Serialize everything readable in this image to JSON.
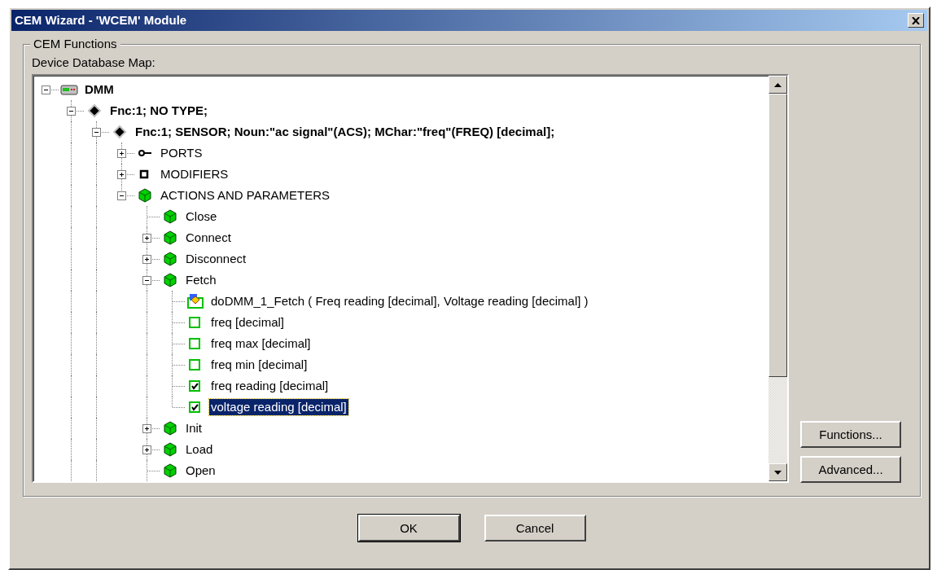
{
  "window": {
    "title": "CEM Wizard - 'WCEM' Module"
  },
  "group": {
    "title": "CEM Functions",
    "tree_label": "Device Database Map:",
    "tree": [
      {
        "label": "DMM",
        "bold": true,
        "kind": "device",
        "expanded": true,
        "selected": false,
        "children": [
          {
            "label": "Fnc:1; NO TYPE;",
            "bold": true,
            "kind": "function",
            "expanded": true,
            "selected": false,
            "continues_below": true,
            "children": [
              {
                "label": "Fnc:1; SENSOR; Noun:\"ac signal\"(ACS); MChar:\"freq\"(FREQ) [decimal];",
                "bold": true,
                "kind": "function",
                "expanded": true,
                "selected": false,
                "continues_below": true,
                "children": [
                  {
                    "label": "PORTS",
                    "bold": false,
                    "kind": "ports",
                    "expanded": false,
                    "selected": false
                  },
                  {
                    "label": "MODIFIERS",
                    "bold": false,
                    "kind": "modifiers",
                    "expanded": false,
                    "selected": false
                  },
                  {
                    "label": "ACTIONS AND PARAMETERS",
                    "bold": false,
                    "kind": "action",
                    "expanded": true,
                    "selected": false,
                    "children": [
                      {
                        "label": "Close",
                        "bold": false,
                        "kind": "action",
                        "selected": false
                      },
                      {
                        "label": "Connect",
                        "bold": false,
                        "kind": "action",
                        "expanded": false,
                        "selected": false
                      },
                      {
                        "label": "Disconnect",
                        "bold": false,
                        "kind": "action",
                        "expanded": false,
                        "selected": false
                      },
                      {
                        "label": "Fetch",
                        "bold": false,
                        "kind": "action",
                        "expanded": true,
                        "selected": false,
                        "children": [
                          {
                            "label": "doDMM_1_Fetch ( Freq reading [decimal], Voltage reading [decimal] )",
                            "bold": false,
                            "kind": "method",
                            "selected": false
                          },
                          {
                            "label": "freq [decimal]",
                            "bold": false,
                            "kind": "parameter",
                            "checked": false,
                            "selected": false
                          },
                          {
                            "label": "freq max [decimal]",
                            "bold": false,
                            "kind": "parameter",
                            "checked": false,
                            "selected": false
                          },
                          {
                            "label": "freq min [decimal]",
                            "bold": false,
                            "kind": "parameter",
                            "checked": false,
                            "selected": false
                          },
                          {
                            "label": "freq reading [decimal]",
                            "bold": false,
                            "kind": "parameter",
                            "checked": true,
                            "selected": false
                          },
                          {
                            "label": "voltage reading [decimal]",
                            "bold": false,
                            "kind": "parameter",
                            "checked": true,
                            "selected": true
                          }
                        ]
                      },
                      {
                        "label": "Init",
                        "bold": false,
                        "kind": "action",
                        "expanded": false,
                        "selected": false
                      },
                      {
                        "label": "Load",
                        "bold": false,
                        "kind": "action",
                        "expanded": false,
                        "selected": false
                      },
                      {
                        "label": "Open",
                        "bold": false,
                        "kind": "action",
                        "selected": false,
                        "continues_below": true
                      }
                    ]
                  }
                ]
              }
            ]
          }
        ]
      }
    ]
  },
  "side_buttons": [
    "Functions...",
    "Advanced..."
  ],
  "buttons": [
    {
      "label": "OK",
      "default": true
    },
    {
      "label": "Cancel",
      "default": false
    }
  ]
}
